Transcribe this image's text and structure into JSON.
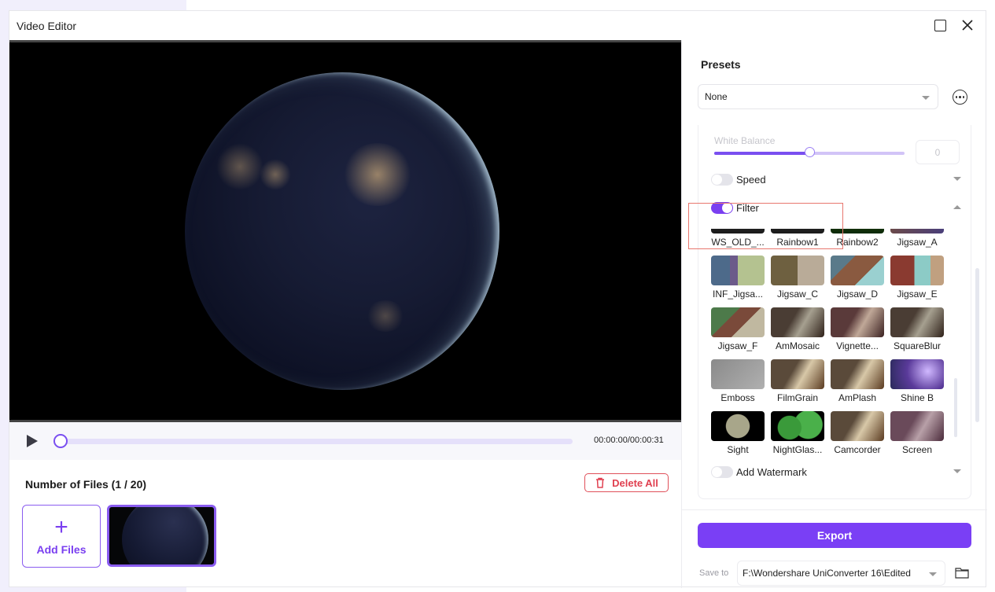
{
  "window": {
    "title": "Video Editor"
  },
  "player": {
    "time": "00:00:00/00:00:31",
    "progress": 0
  },
  "files": {
    "title": "Number of Files (1 / 20)",
    "delete_all": "Delete All",
    "add_files": "Add Files",
    "add_icon": "+"
  },
  "panel": {
    "presets_title": "Presets",
    "preset_value": "None",
    "white_balance": {
      "label": "White Balance",
      "value": "0",
      "position": 0.5
    },
    "speed": {
      "label": "Speed",
      "enabled": false
    },
    "filter": {
      "label": "Filter",
      "enabled": true
    },
    "watermark": {
      "label": "Add Watermark",
      "enabled": false
    },
    "filters": [
      {
        "name": "WS_OLD_...",
        "style": "dark"
      },
      {
        "name": "Rainbow1",
        "style": "dark"
      },
      {
        "name": "Rainbow2",
        "style": "green"
      },
      {
        "name": "Jigsaw_A",
        "style": "purple"
      },
      {
        "name": "INF_Jigsa...",
        "style": "jigsaw1"
      },
      {
        "name": "Jigsaw_C",
        "style": "jigsaw2"
      },
      {
        "name": "Jigsaw_D",
        "style": "jigsaw3"
      },
      {
        "name": "Jigsaw_E",
        "style": "jigsaw4"
      },
      {
        "name": "Jigsaw_F",
        "style": "jigsaw5"
      },
      {
        "name": "AmMosaic",
        "style": "photo-dark"
      },
      {
        "name": "Vignette...",
        "style": "photo-warm"
      },
      {
        "name": "SquareBlur",
        "style": "photo-dark"
      },
      {
        "name": "Emboss",
        "style": "emboss"
      },
      {
        "name": "FilmGrain",
        "style": "photo"
      },
      {
        "name": "AmPlash",
        "style": "photo"
      },
      {
        "name": "Shine B",
        "style": "shine"
      },
      {
        "name": "Sight",
        "style": "sight"
      },
      {
        "name": "NightGlas...",
        "style": "night"
      },
      {
        "name": "Camcorder",
        "style": "photo"
      },
      {
        "name": "Screen",
        "style": "screen"
      }
    ],
    "export": "Export",
    "save_to_label": "Save to",
    "save_to_path": "F:\\Wondershare UniConverter 16\\Edited"
  },
  "colors": {
    "accent": "#7a3ff5",
    "danger": "#e04050",
    "highlight": "#e8776e"
  }
}
